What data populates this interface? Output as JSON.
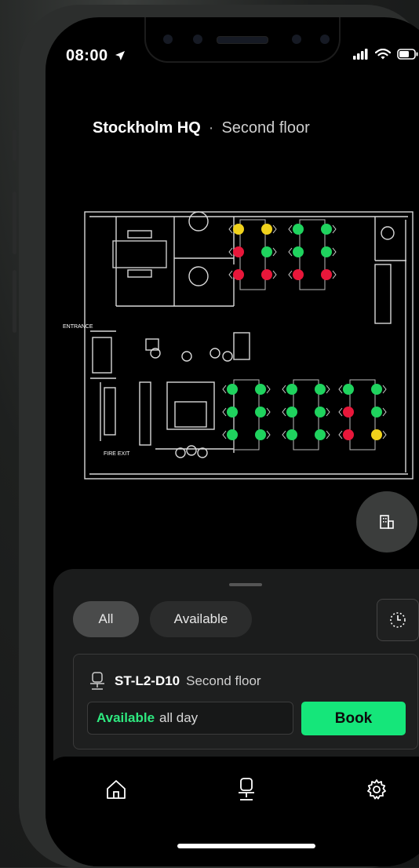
{
  "status_bar": {
    "time": "08:00"
  },
  "header": {
    "building": "Stockholm HQ",
    "separator": "·",
    "floor": "Second floor"
  },
  "floor_plan": {
    "labels": {
      "entrance": "ENTRANCE",
      "fire_exit": "FIRE EXIT"
    },
    "status_colors": {
      "available": "#1fd35e",
      "occupied": "#e8173a",
      "partial": "#f0d21c"
    },
    "desk_blocks": [
      {
        "name": "top-block-1",
        "rows": [
          [
            "partial",
            "partial"
          ],
          [
            "occupied",
            "available"
          ],
          [
            "occupied",
            "occupied"
          ]
        ]
      },
      {
        "name": "top-block-2",
        "rows": [
          [
            "available",
            "available"
          ],
          [
            "available",
            "available"
          ],
          [
            "occupied",
            "occupied"
          ]
        ]
      },
      {
        "name": "bottom-block-1",
        "rows": [
          [
            "available",
            "available"
          ],
          [
            "available",
            "available"
          ],
          [
            "available",
            "available"
          ]
        ]
      },
      {
        "name": "bottom-block-2",
        "rows": [
          [
            "available",
            "available"
          ],
          [
            "available",
            "available"
          ],
          [
            "available",
            "available"
          ]
        ]
      },
      {
        "name": "bottom-block-3",
        "rows": [
          [
            "available",
            "available"
          ],
          [
            "occupied",
            "available"
          ],
          [
            "occupied",
            "partial"
          ]
        ]
      }
    ]
  },
  "fab": {
    "icon": "building-icon"
  },
  "sheet": {
    "filters": {
      "all": "All",
      "available": "Available"
    },
    "history_icon": "clock-history-icon",
    "desk_card": {
      "icon": "desk-chair-icon",
      "desk_id": "ST-L2-D10",
      "floor": "Second floor",
      "availability_status": "Available",
      "availability_detail": "all day",
      "book_label": "Book"
    }
  },
  "tab_bar": {
    "items": [
      {
        "icon": "home-icon"
      },
      {
        "icon": "desk-chair-icon"
      },
      {
        "icon": "gear-icon"
      }
    ]
  },
  "colors": {
    "accent": "#15e67a",
    "background": "#000000",
    "sheet": "#1b1c1c"
  }
}
